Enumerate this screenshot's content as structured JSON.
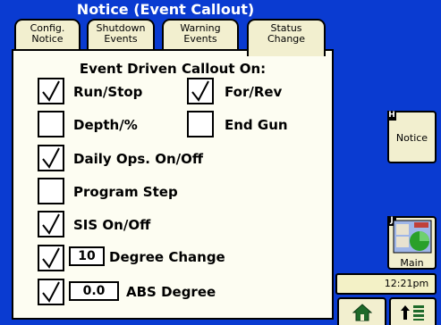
{
  "title": "Notice (Event Callout)",
  "tabs": [
    {
      "line1": "Config.",
      "line2": "Notice"
    },
    {
      "line1": "Shutdown",
      "line2": "Events"
    },
    {
      "line1": "Warning",
      "line2": "Events"
    },
    {
      "line1": "Status",
      "line2": "Change"
    }
  ],
  "panel": {
    "heading": "Event Driven Callout On:",
    "options": {
      "run_stop": {
        "label": "Run/Stop",
        "checked": true
      },
      "for_rev": {
        "label": "For/Rev",
        "checked": true
      },
      "depth": {
        "label": "Depth/%",
        "checked": false
      },
      "end_gun": {
        "label": "End Gun",
        "checked": false
      },
      "daily_ops": {
        "label": "Daily Ops. On/Off",
        "checked": true
      },
      "program_step": {
        "label": "Program Step",
        "checked": false
      },
      "sis": {
        "label": "SIS On/Off",
        "checked": true
      },
      "degree_change": {
        "label": "Degree Change",
        "value": "10",
        "checked": true
      },
      "abs_degree": {
        "label": "ABS Degree",
        "value": "0.0",
        "checked": true
      }
    }
  },
  "side": {
    "notice": {
      "key": "H",
      "label": "Notice"
    },
    "main": {
      "key": "J",
      "label": "Main"
    },
    "clock": "12:21pm",
    "home_icon": "home-icon",
    "up_list_icon": "arrow-up-list-icon"
  },
  "colors": {
    "background": "#0a3bd1",
    "tab": "#f2efcf",
    "panel": "#fdfdf2",
    "clock": "#f3f1c6"
  }
}
